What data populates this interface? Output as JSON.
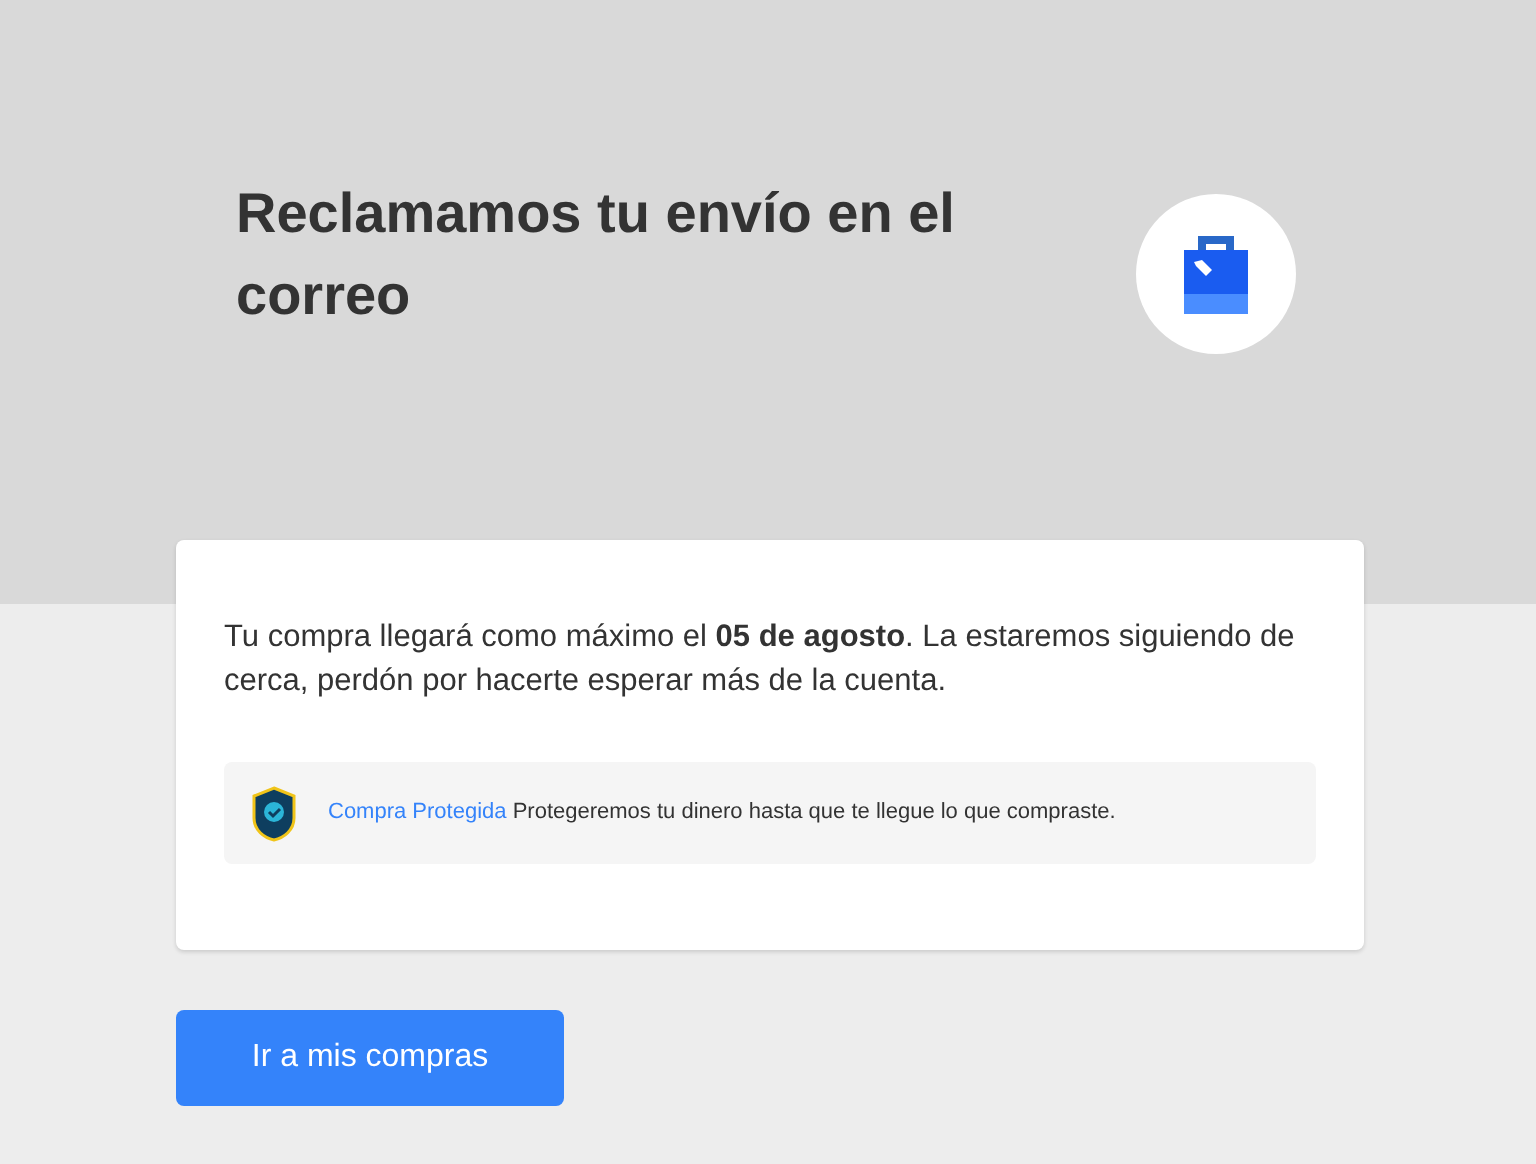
{
  "header": {
    "title": "Reclamamos tu envío en el correo"
  },
  "card": {
    "message": "Tu compra llegará como máximo el **05 de agosto**. La estaremos siguiendo de cerca, perdón por hacerte esperar más de la cuenta.",
    "protection": {
      "link": "Compra Protegida",
      "text": "Protegeremos tu dinero hasta que te llegue lo que compraste."
    }
  },
  "buttons": [
    {
      "label": "Ir a mis compras"
    }
  ]
}
